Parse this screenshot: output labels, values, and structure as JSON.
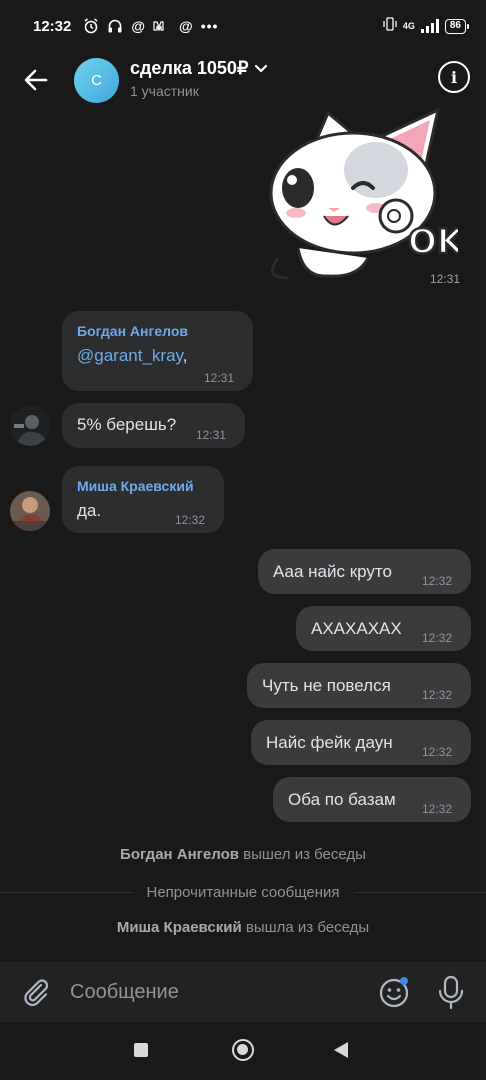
{
  "status_bar": {
    "time": "12:32",
    "icons": [
      "alarm-icon",
      "headphones-icon",
      "at-icon",
      "vk-icon",
      "at-icon",
      "more-icon"
    ],
    "network": "4G",
    "battery": "86"
  },
  "header": {
    "avatar_letter": "С",
    "title": "сделка 1050₽",
    "subtitle": "1 участник"
  },
  "sticker": {
    "caption": "OK",
    "time": "12:31"
  },
  "messages": [
    {
      "sender": "Богдан Ангелов",
      "text": "@garant_kray",
      "trail": ",",
      "time": "12:31"
    },
    {
      "text": "5% берешь?",
      "time": "12:31"
    },
    {
      "sender": "Миша Краевский",
      "text": "да.",
      "time": "12:32"
    },
    {
      "text": "Ааа найс круто",
      "time": "12:32"
    },
    {
      "text": "АХАХАХАХ",
      "time": "12:32"
    },
    {
      "text": "Чуть не повелся",
      "time": "12:32"
    },
    {
      "text": "Найс фейк даун",
      "time": "12:32"
    },
    {
      "text": "Оба по базам",
      "time": "12:32"
    }
  ],
  "system": {
    "left1_name": "Богдан Ангелов",
    "left1_action": "вышел из беседы",
    "unread": "Непрочитанные сообщения",
    "left2_name": "Миша Краевский",
    "left2_action": "вышла из беседы"
  },
  "composer": {
    "placeholder": "Сообщение"
  },
  "colors": {
    "background": "#19191a",
    "bubble_in": "#2c2d2e",
    "bubble_out": "#3a3b3c",
    "accent": "#71aaeb"
  }
}
